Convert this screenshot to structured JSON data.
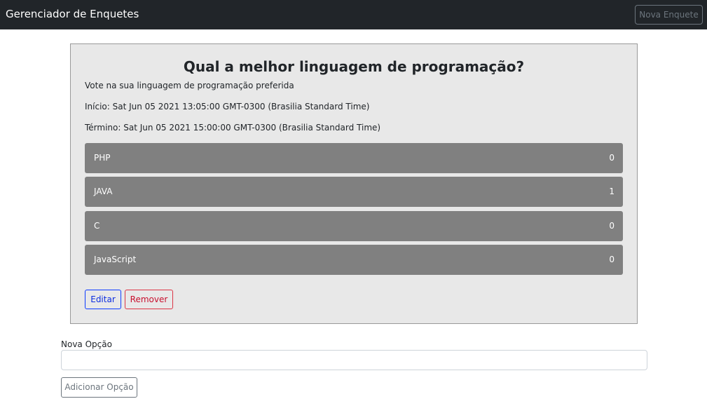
{
  "navbar": {
    "brand": "Gerenciador de Enquetes",
    "new_poll_label": "Nova Enquete"
  },
  "poll": {
    "title": "Qual a melhor linguagem de programação?",
    "description": "Vote na sua linguagem de programação preferida",
    "start": "Início: Sat Jun 05 2021 13:05:00 GMT-0300 (Brasilia Standard Time)",
    "end": "Término: Sat Jun 05 2021 15:00:00 GMT-0300 (Brasilia Standard Time)",
    "options": [
      {
        "name": "PHP",
        "votes": "0"
      },
      {
        "name": "JAVA",
        "votes": "1"
      },
      {
        "name": "C",
        "votes": "0"
      },
      {
        "name": "JavaScript",
        "votes": "0"
      }
    ],
    "edit_label": "Editar",
    "remove_label": "Remover"
  },
  "new_option": {
    "label": "Nova Opção",
    "value": "",
    "add_label": "Adicionar Opção"
  }
}
